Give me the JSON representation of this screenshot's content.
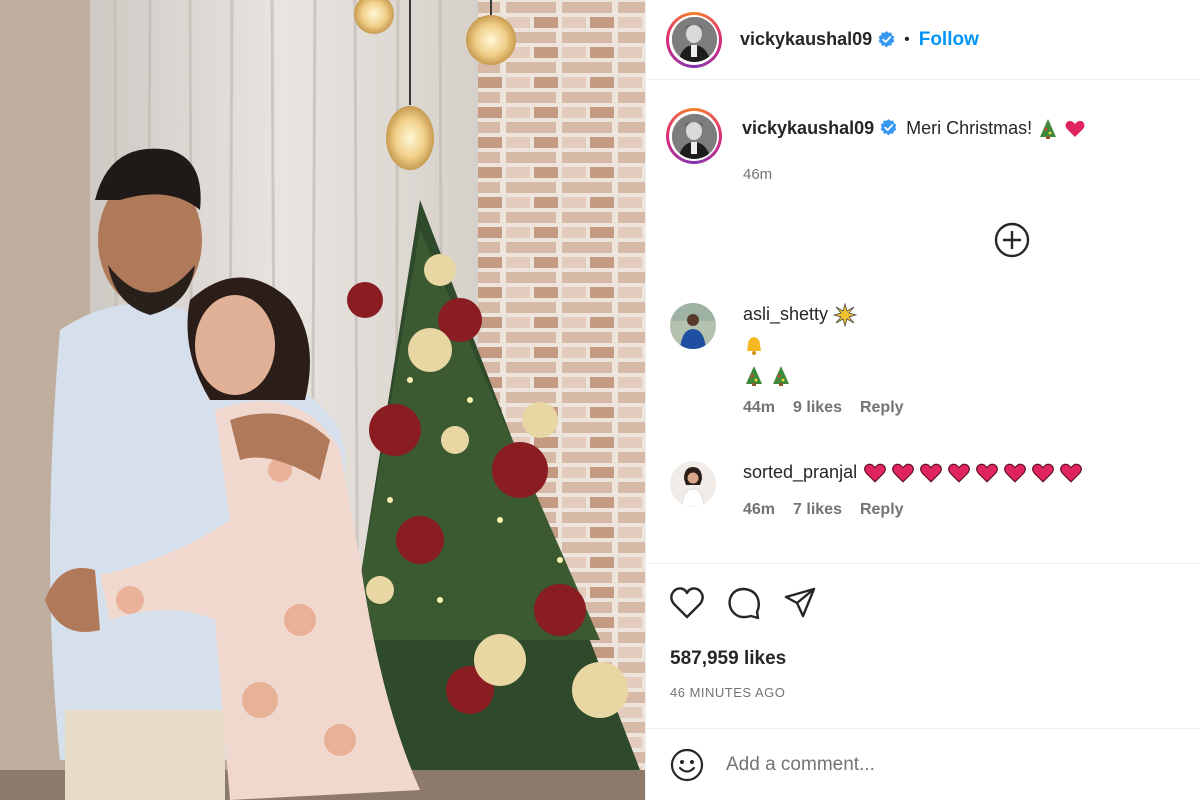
{
  "post": {
    "username": "vickykaushal09",
    "follow_label": "Follow",
    "separator": "•",
    "caption": "Meri Christmas!",
    "caption_time": "46m",
    "likes": "587,959 likes",
    "posted_ago": "46 MINUTES AGO"
  },
  "comments": [
    {
      "username": "asli_shetty",
      "time": "44m",
      "likes": "9 likes",
      "reply": "Reply",
      "emojis": [
        "sparkle-burst",
        "bell",
        "christmas-tree",
        "christmas-tree"
      ]
    },
    {
      "username": "sorted_pranjal",
      "time": "46m",
      "likes": "7 likes",
      "reply": "Reply",
      "emojis": [
        "heart",
        "heart",
        "heart",
        "heart",
        "heart",
        "heart",
        "heart",
        "heart"
      ]
    }
  ],
  "composer": {
    "placeholder": "Add a comment...",
    "icon": "emoji-smile-icon"
  },
  "actions": {
    "like_icon": "heart-outline-icon",
    "comment_icon": "speech-bubble-icon",
    "share_icon": "paper-plane-icon",
    "more_comments_icon": "plus-circle-icon"
  },
  "colors": {
    "link": "#0095f6",
    "verified": "#3897f0",
    "heart": "#e0245e",
    "muted": "#737373"
  }
}
